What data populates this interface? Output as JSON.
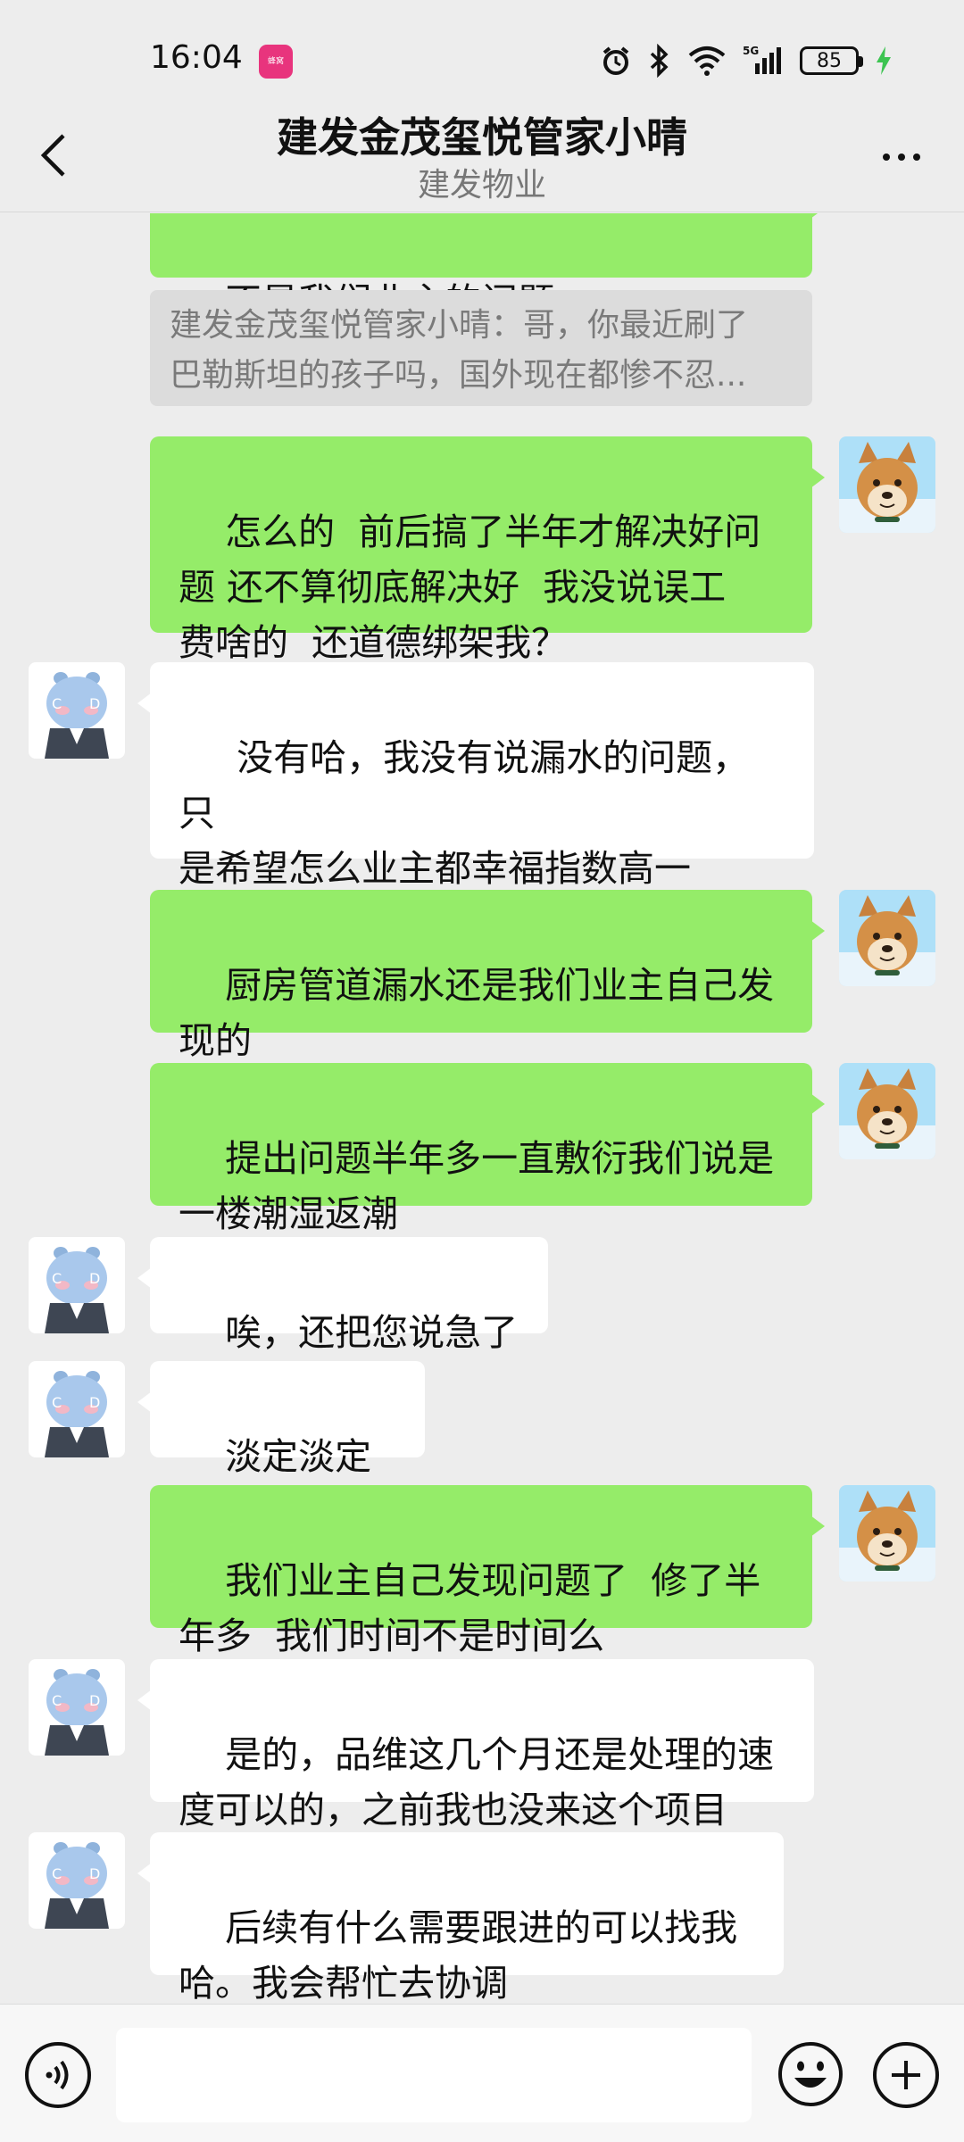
{
  "status_bar": {
    "time": "16:04",
    "app_icon_text": "蜂窝",
    "network": "5G",
    "battery": "85",
    "battery_level": 0.85
  },
  "header": {
    "title": "建发金茂玺悦管家小晴",
    "subtitle": "建发物业"
  },
  "messages": [
    {
      "sender": "me",
      "text": "不是我们业主的问题"
    },
    {
      "sender": "quote",
      "lines": [
        "建发金茂玺悦管家小晴：哥，你最近刷了",
        "巴勒斯坦的孩子吗，国外现在都惨不忍..."
      ]
    },
    {
      "sender": "me",
      "text": "怎么的  前后搞了半年才解决好问\n题 还不算彻底解决好  我没说误工\n费啥的  还道德绑架我？"
    },
    {
      "sender": "other",
      "text": " 没有哈，我没有说漏水的问题，只\n是希望怎么业主都幸福指数高一\n点。😊"
    },
    {
      "sender": "me",
      "text": "厨房管道漏水还是我们业主自己发\n现的"
    },
    {
      "sender": "me",
      "text": "提出问题半年多一直敷衍我们说是\n一楼潮湿返潮"
    },
    {
      "sender": "other",
      "text": "唉，还把您说急了"
    },
    {
      "sender": "other",
      "text": "淡定淡定哈"
    },
    {
      "sender": "me",
      "text": "我们业主自己发现问题了  修了半\n年多  我们时间不是时间么"
    },
    {
      "sender": "other",
      "text": "是的，品维这几个月还是处理的速\n度可以的，之前我也没来这个项目"
    },
    {
      "sender": "other",
      "text": "后续有什么需要跟进的可以找我\n哈。我会帮忙去协调"
    }
  ],
  "avatars": {
    "me": "shiba-dog-avatar",
    "other": "blue-hippo-avatar"
  },
  "input": {
    "placeholder": ""
  },
  "icons": {
    "back": "chevron-left-icon",
    "more": "more-icon",
    "voice": "voice-icon",
    "emoji": "emoji-icon",
    "plus": "plus-icon"
  },
  "colors": {
    "my_bubble": "#95ec69",
    "their_bubble": "#ffffff",
    "background": "#ededed"
  }
}
